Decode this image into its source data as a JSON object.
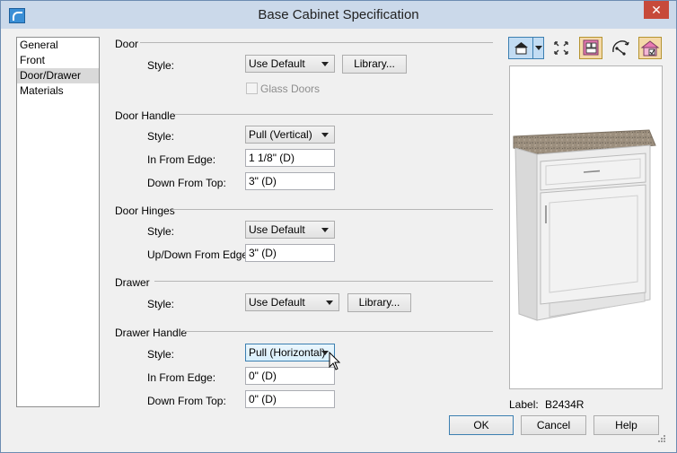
{
  "window": {
    "title": "Base Cabinet Specification",
    "close_label": "✕"
  },
  "nav": {
    "items": [
      {
        "label": "General",
        "selected": false
      },
      {
        "label": "Front",
        "selected": false
      },
      {
        "label": "Door/Drawer",
        "selected": true
      },
      {
        "label": "Materials",
        "selected": false
      }
    ]
  },
  "door": {
    "section_label": "Door",
    "style_label": "Style:",
    "style_value": "Use Default",
    "library_label": "Library...",
    "glass_doors_label": "Glass Doors",
    "glass_doors_checked": false
  },
  "door_handle": {
    "section_label": "Door Handle",
    "style_label": "Style:",
    "style_value": "Pull (Vertical)",
    "in_from_edge_label": "In From Edge:",
    "in_from_edge_value": "1 1/8\" (D)",
    "down_from_top_label": "Down From Top:",
    "down_from_top_value": "3\" (D)"
  },
  "door_hinges": {
    "section_label": "Door Hinges",
    "style_label": "Style:",
    "style_value": "Use Default",
    "updown_label": "Up/Down From Edge:",
    "updown_value": "3\" (D)"
  },
  "drawer": {
    "section_label": "Drawer",
    "style_label": "Style:",
    "style_value": "Use Default",
    "library_label": "Library..."
  },
  "drawer_handle": {
    "section_label": "Drawer Handle",
    "style_label": "Style:",
    "style_value": "Pull (Horizontal)",
    "in_from_edge_label": "In From Edge:",
    "in_from_edge_value": "0\" (D)",
    "down_from_top_label": "Down From Top:",
    "down_from_top_value": "0\" (D)"
  },
  "preview": {
    "label_caption": "Label:",
    "label_value": "B2434R",
    "icons": [
      "camera-view-icon",
      "fit-view-icon",
      "color-toggle-icon",
      "orbit-icon",
      "material-view-icon"
    ]
  },
  "footer": {
    "ok_label": "OK",
    "cancel_label": "Cancel",
    "help_label": "Help"
  },
  "colors": {
    "titlebar": "#cbd9ea",
    "close_button": "#c74a3a",
    "dialog_bg": "#f0f0f0",
    "accent_border": "#3c7fb1",
    "countertop": "#9c8f7e",
    "cabinet": "#ececec"
  }
}
